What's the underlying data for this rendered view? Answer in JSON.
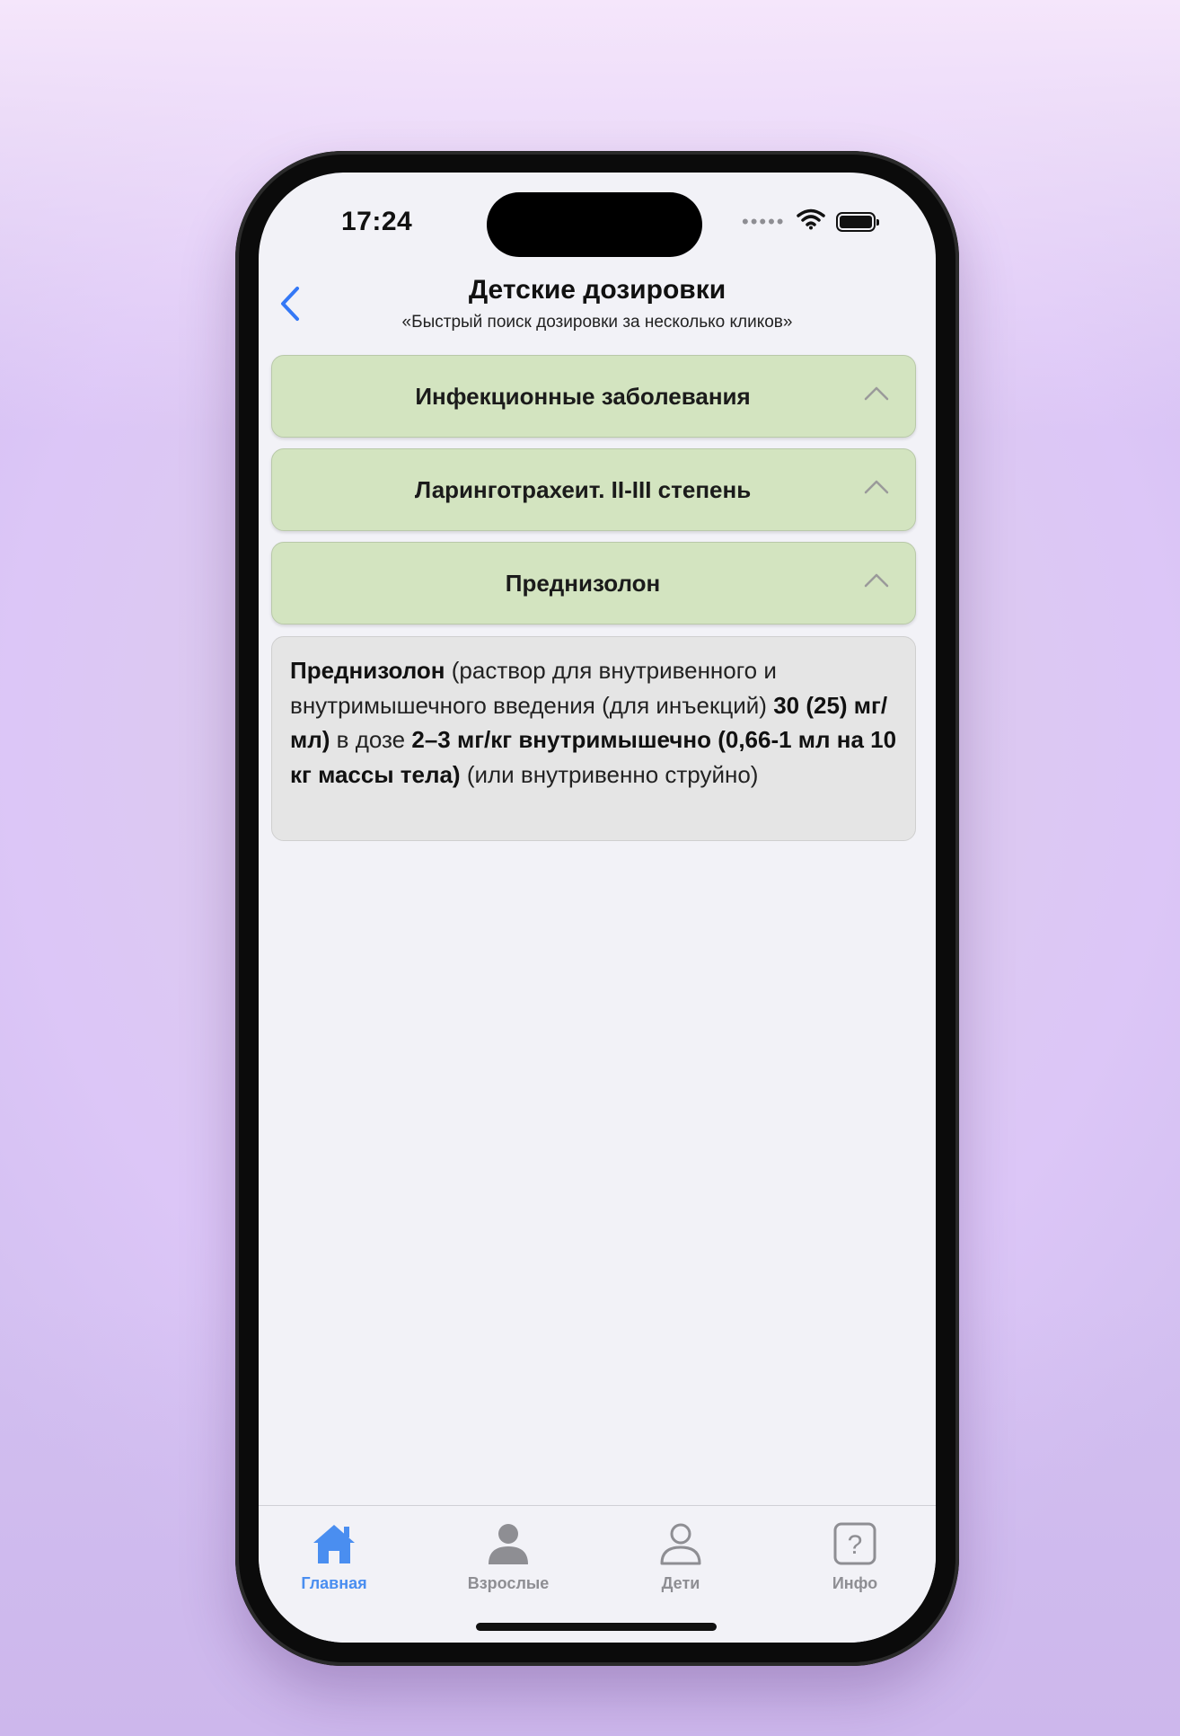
{
  "status": {
    "time": "17:24",
    "signal_dots": "•••••",
    "icons": [
      "wifi-icon",
      "battery-icon"
    ]
  },
  "header": {
    "title": "Детские дозировки",
    "subtitle": "«Быстрый поиск дозировки за несколько кликов»",
    "back_icon": "chevron-left-icon"
  },
  "accordion": [
    {
      "label": "Инфекционные заболевания",
      "icon": "chevron-up-icon"
    },
    {
      "label": "Ларинготрахеит. II-III степень",
      "icon": "chevron-up-icon"
    },
    {
      "label": "Преднизолон",
      "icon": "chevron-up-icon"
    }
  ],
  "card": {
    "drug_name": "Преднизолон",
    "form_text": "(раствор для внутривенного и внутримышечного введения (для инъекций)",
    "concentration": "30 (25) мг/мл)",
    "dose_prefix": "в дозе",
    "dose": "2–3 мг/кг внутримышечно (0,66-1 мл на 10 кг массы тела)",
    "tail": "(или внутривенно струйно)"
  },
  "tabbar": [
    {
      "label": "Главная",
      "icon": "home-icon",
      "active": true
    },
    {
      "label": "Взрослые",
      "icon": "person-filled-icon",
      "active": false
    },
    {
      "label": "Дети",
      "icon": "person-outline-icon",
      "active": false
    },
    {
      "label": "Инфо",
      "icon": "question-square-icon",
      "active": false
    }
  ],
  "colors": {
    "accent": "#4a8ef0",
    "accordion_bg": "#d3e4c0",
    "card_bg": "#e5e5e5",
    "inactive": "#8e8e93"
  }
}
